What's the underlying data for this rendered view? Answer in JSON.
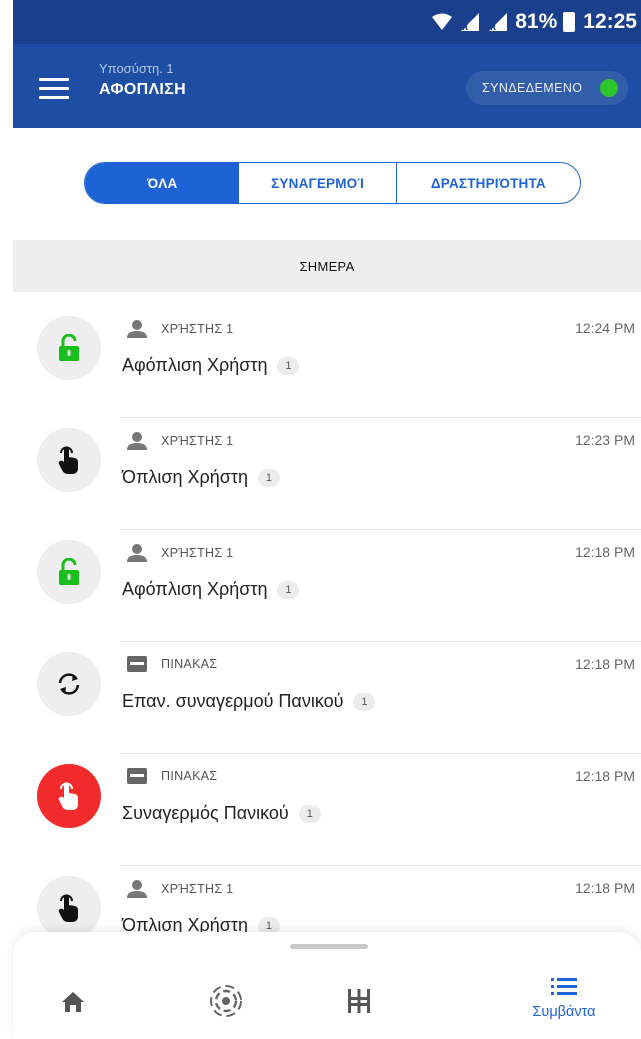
{
  "status_bar": {
    "battery": "81%",
    "time": "12:25"
  },
  "app_bar": {
    "subtitle": "Υποσύστη. 1",
    "title": "ΑΦΟΠΛΙΣΗ",
    "connection_status": "ΣΥΝΔΕΔΕΜΕΝΟ",
    "menu_icon": "hamburger-menu-icon",
    "status_color": "#2ec52e"
  },
  "tabs": [
    {
      "label": "ΌΛΑ",
      "active": true
    },
    {
      "label": "ΣΥΝΑΓΕΡΜΟΊ",
      "active": false
    },
    {
      "label": "ΔΡΑΣΤΗΡΙΌΤΗΤΑ",
      "active": false
    }
  ],
  "day_header": "ΣΗΜΕΡΑ",
  "events": [
    {
      "icon": "unlock-icon",
      "source_icon": "user-icon",
      "source": "ΧΡΉΣΤΗΣ 1",
      "time": "12:24 PM",
      "name": "Αφόπλιση Χρήστη",
      "count": "1"
    },
    {
      "icon": "touch-hand-icon",
      "source_icon": "user-icon",
      "source": "ΧΡΉΣΤΗΣ 1",
      "time": "12:23 PM",
      "name": "Όπλιση Χρήστη",
      "count": "1"
    },
    {
      "icon": "unlock-icon",
      "source_icon": "user-icon",
      "source": "ΧΡΉΣΤΗΣ 1",
      "time": "12:18 PM",
      "name": "Αφόπλιση Χρήστη",
      "count": "1"
    },
    {
      "icon": "sync-icon",
      "source_icon": "panel-icon",
      "source": "ΠΙΝΑΚΑΣ",
      "time": "12:18 PM",
      "name": "Επαν. συναγερμού Πανικού",
      "count": "1"
    },
    {
      "icon": "touch-hand-icon",
      "source_icon": "panel-icon",
      "source": "ΠΙΝΑΚΑΣ",
      "time": "12:18 PM",
      "name": "Συναγερμός Πανικού",
      "count": "1",
      "alert": true
    },
    {
      "icon": "touch-hand-icon",
      "source_icon": "user-icon",
      "source": "ΧΡΉΣΤΗΣ 1",
      "time": "12:18 PM",
      "name": "Όπλιση Χρήστη",
      "count": "1"
    }
  ],
  "bottom_nav": [
    {
      "icon": "home-icon",
      "label": ""
    },
    {
      "icon": "sensor-icon",
      "label": ""
    },
    {
      "icon": "equalizer-icon",
      "label": ""
    },
    {
      "icon": "list-icon",
      "label": "Συμβάντα",
      "active": true
    }
  ],
  "colors": {
    "primary": "#1e63d5",
    "app_bar": "#1e4ea3",
    "status_bar": "#1a3f8c",
    "unlock_green": "#1bbf1b",
    "alarm_red": "#f12b2b"
  }
}
